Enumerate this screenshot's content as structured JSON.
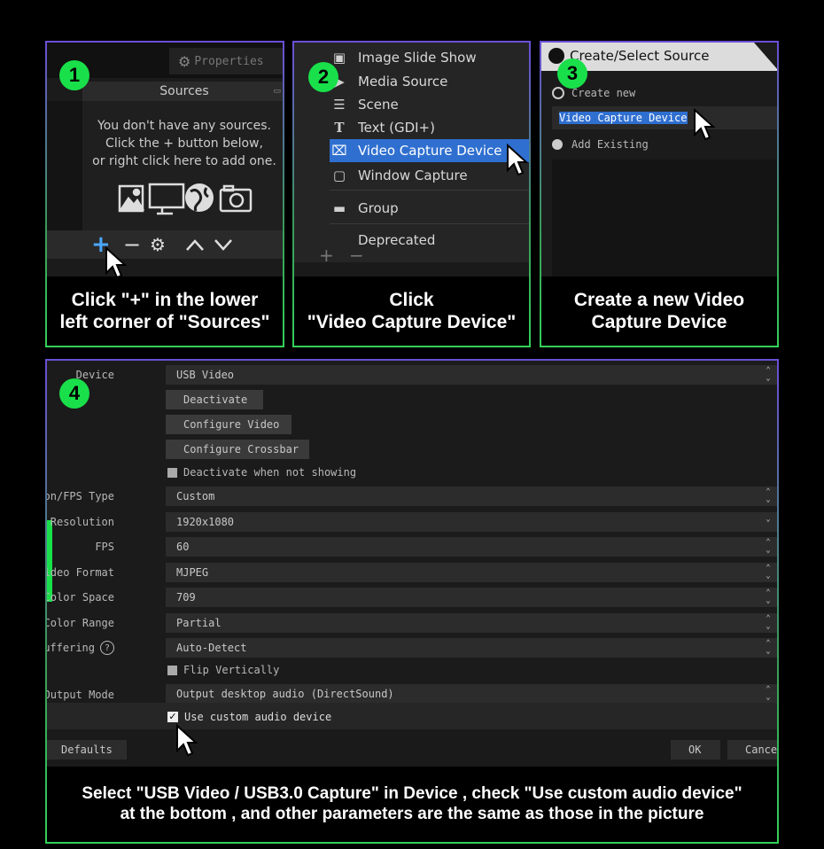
{
  "panel1": {
    "badge": "1",
    "properties_label": "Properties",
    "sources_title": "Sources",
    "empty_message": [
      "You don't have any sources.",
      "Click the + button below,",
      "or right click here to add one."
    ],
    "caption": [
      "Click \"+\" in the lower",
      "left corner of \"Sources\""
    ]
  },
  "panel2": {
    "badge": "2",
    "menu_items": [
      "Image Slide Show",
      "Media Source",
      "Scene",
      "Text (GDI+)",
      "Video Capture Device",
      "Window Capture",
      "Group",
      "Deprecated"
    ],
    "caption": [
      "Click",
      "\"Video Capture Device\""
    ]
  },
  "panel3": {
    "badge": "3",
    "dialog_title": "Create/Select Source",
    "create_new_label": "Create new",
    "name_value": "Video Capture Device",
    "add_existing_label": "Add Existing",
    "caption": [
      "Create a new Video",
      "Capture Device"
    ]
  },
  "panel4": {
    "badge": "4",
    "device_label": "Device",
    "device_value": "USB Video",
    "deactivate_button": "Deactivate",
    "configure_video_button": "Configure Video",
    "configure_crossbar_button": "Configure Crossbar",
    "deactivate_when_not_showing": "Deactivate when not showing",
    "fields": [
      {
        "label": "Resolution/FPS Type",
        "value": "Custom"
      },
      {
        "label": "Resolution",
        "value": "1920x1080"
      },
      {
        "label": "FPS",
        "value": "60"
      },
      {
        "label": "Video Format",
        "value": "MJPEG"
      },
      {
        "label": "Color Space",
        "value": "709"
      },
      {
        "label": "Color Range",
        "value": "Partial"
      },
      {
        "label": "Buffering",
        "value": "Auto-Detect"
      }
    ],
    "flip_vertically": "Flip Vertically",
    "audio_output_label": "Audio Output Mode",
    "audio_output_value": "Output desktop audio (DirectSound)",
    "use_custom_audio": "Use custom audio device",
    "defaults_button": "Defaults",
    "ok_button": "OK",
    "cancel_button": "Cancel",
    "caption": [
      "Select \"USB Video / USB3.0 Capture\" in Device , check \"Use custom audio device\"",
      "at the bottom , and other parameters are the same as those in the picture"
    ]
  },
  "colors": {
    "accent_green": "#19e04a",
    "selection_blue": "#2f6fd0",
    "panel_bg": "#1b1b1b"
  }
}
